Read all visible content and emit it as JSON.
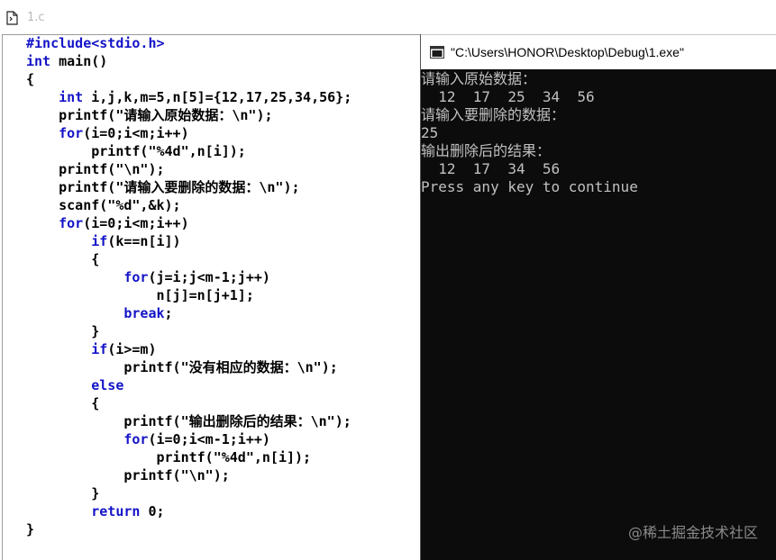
{
  "editor": {
    "tab_title": "1.c",
    "icon": "document-icon",
    "code_lines": [
      [
        {
          "t": "#include<stdio.h>",
          "c": "dir"
        }
      ],
      [
        {
          "t": "int",
          "c": "kw"
        },
        {
          "t": " main()",
          "c": ""
        }
      ],
      [
        {
          "t": "{",
          "c": ""
        }
      ],
      [
        {
          "t": "    ",
          "c": ""
        },
        {
          "t": "int",
          "c": "kw"
        },
        {
          "t": " i,j,k,m=5,n[5]={12,17,25,34,56};",
          "c": ""
        }
      ],
      [
        {
          "t": "    printf(\"请输入原始数据：\\n\");",
          "c": ""
        }
      ],
      [
        {
          "t": "    ",
          "c": ""
        },
        {
          "t": "for",
          "c": "kw"
        },
        {
          "t": "(i=0;i<m;i++)",
          "c": ""
        }
      ],
      [
        {
          "t": "        printf(\"%4d\",n[i]);",
          "c": ""
        }
      ],
      [
        {
          "t": "    printf(\"\\n\");",
          "c": ""
        }
      ],
      [
        {
          "t": "    printf(\"请输入要删除的数据：\\n\");",
          "c": ""
        }
      ],
      [
        {
          "t": "    scanf(\"%d\",&k);",
          "c": ""
        }
      ],
      [
        {
          "t": "    ",
          "c": ""
        },
        {
          "t": "for",
          "c": "kw"
        },
        {
          "t": "(i=0;i<m;i++)",
          "c": ""
        }
      ],
      [
        {
          "t": "        ",
          "c": ""
        },
        {
          "t": "if",
          "c": "kw"
        },
        {
          "t": "(k==n[i])",
          "c": ""
        }
      ],
      [
        {
          "t": "        {",
          "c": ""
        }
      ],
      [
        {
          "t": "            ",
          "c": ""
        },
        {
          "t": "for",
          "c": "kw"
        },
        {
          "t": "(j=i;j<m-1;j++)",
          "c": ""
        }
      ],
      [
        {
          "t": "                n[j]=n[j+1];",
          "c": ""
        }
      ],
      [
        {
          "t": "            ",
          "c": ""
        },
        {
          "t": "break",
          "c": "kw"
        },
        {
          "t": ";",
          "c": ""
        }
      ],
      [
        {
          "t": "        }",
          "c": ""
        }
      ],
      [
        {
          "t": "        ",
          "c": ""
        },
        {
          "t": "if",
          "c": "kw"
        },
        {
          "t": "(i>=m)",
          "c": ""
        }
      ],
      [
        {
          "t": "            printf(\"没有相应的数据：\\n\");",
          "c": ""
        }
      ],
      [
        {
          "t": "        ",
          "c": ""
        },
        {
          "t": "else",
          "c": "kw"
        }
      ],
      [
        {
          "t": "        {",
          "c": ""
        }
      ],
      [
        {
          "t": "            printf(\"输出删除后的结果：\\n\");",
          "c": ""
        }
      ],
      [
        {
          "t": "            ",
          "c": ""
        },
        {
          "t": "for",
          "c": "kw"
        },
        {
          "t": "(i=0;i<m-1;i++)",
          "c": ""
        }
      ],
      [
        {
          "t": "                printf(\"%4d\",n[i]);",
          "c": ""
        }
      ],
      [
        {
          "t": "            printf(\"\\n\");",
          "c": ""
        }
      ],
      [
        {
          "t": "        }",
          "c": ""
        }
      ],
      [
        {
          "t": "        ",
          "c": ""
        },
        {
          "t": "return",
          "c": "kw"
        },
        {
          "t": " 0;",
          "c": ""
        }
      ],
      [
        {
          "t": "}",
          "c": ""
        }
      ]
    ]
  },
  "console": {
    "title": "\"C:\\Users\\HONOR\\Desktop\\Debug\\1.exe\"",
    "icon": "console-window-icon",
    "lines": [
      "请输入原始数据：",
      "  12  17  25  34  56",
      "请输入要删除的数据：",
      "25",
      "输出删除后的结果：",
      "  12  17  34  56",
      "Press any key to continue"
    ]
  },
  "watermark": "@稀土掘金技术社区",
  "colors": {
    "keyword": "#1414c8",
    "console_bg": "#0c0c0c",
    "console_text": "#c0c0c0"
  }
}
